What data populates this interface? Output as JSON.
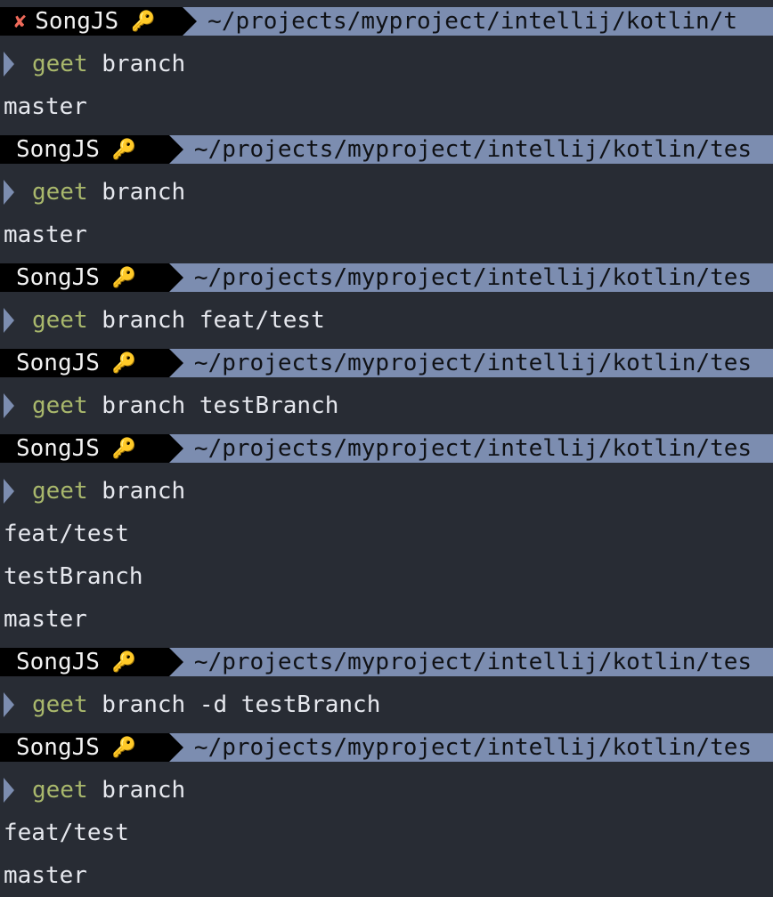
{
  "colors": {
    "background": "#282c34",
    "user_segment": "#000000",
    "path_segment": "#7c8db0",
    "command_verb": "#a9b86c",
    "error_icon": "#ef6a5a",
    "key_icon": "#e8b84a",
    "text": "#e6e8ee"
  },
  "icons": {
    "error": "✘",
    "key": "🔑"
  },
  "lines": [
    {
      "kind": "prompt",
      "user": "SongJS",
      "path": "~/projects/myproject/intellij/kotlin/t",
      "error": true
    },
    {
      "kind": "command",
      "verb": "geet",
      "args": " branch"
    },
    {
      "kind": "output",
      "text": "master"
    },
    {
      "kind": "prompt",
      "user": "SongJS",
      "path": "~/projects/myproject/intellij/kotlin/tes",
      "error": false
    },
    {
      "kind": "command",
      "verb": "geet",
      "args": " branch"
    },
    {
      "kind": "output",
      "text": "master"
    },
    {
      "kind": "prompt",
      "user": "SongJS",
      "path": "~/projects/myproject/intellij/kotlin/tes",
      "error": false
    },
    {
      "kind": "command",
      "verb": "geet",
      "args": " branch feat/test"
    },
    {
      "kind": "prompt",
      "user": "SongJS",
      "path": "~/projects/myproject/intellij/kotlin/tes",
      "error": false
    },
    {
      "kind": "command",
      "verb": "geet",
      "args": " branch testBranch"
    },
    {
      "kind": "prompt",
      "user": "SongJS",
      "path": "~/projects/myproject/intellij/kotlin/tes",
      "error": false
    },
    {
      "kind": "command",
      "verb": "geet",
      "args": " branch"
    },
    {
      "kind": "output",
      "text": "feat/test"
    },
    {
      "kind": "output",
      "text": "testBranch"
    },
    {
      "kind": "output",
      "text": "master"
    },
    {
      "kind": "prompt",
      "user": "SongJS",
      "path": "~/projects/myproject/intellij/kotlin/tes",
      "error": false
    },
    {
      "kind": "command",
      "verb": "geet",
      "args": " branch -d testBranch"
    },
    {
      "kind": "prompt",
      "user": "SongJS",
      "path": "~/projects/myproject/intellij/kotlin/tes",
      "error": false
    },
    {
      "kind": "command",
      "verb": "geet",
      "args": " branch"
    },
    {
      "kind": "output",
      "text": "feat/test"
    },
    {
      "kind": "output",
      "text": "master"
    }
  ]
}
